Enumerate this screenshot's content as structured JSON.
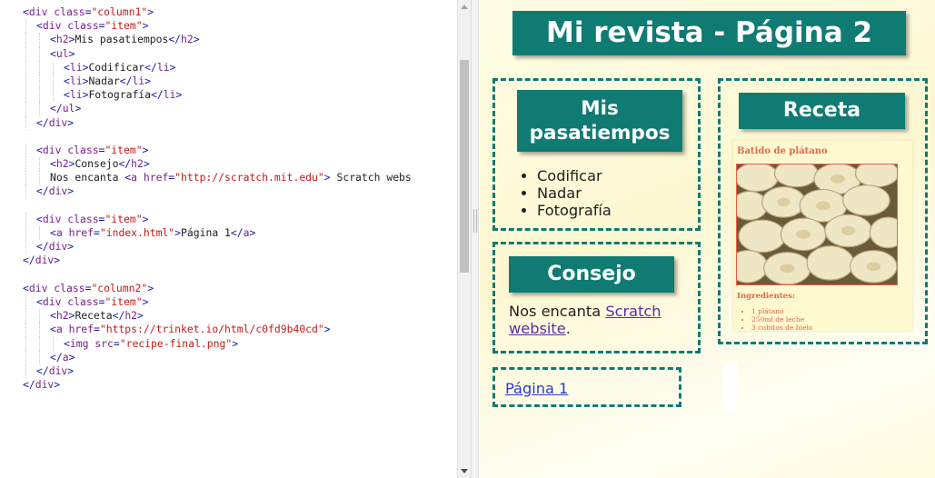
{
  "editor": {
    "lines": [
      {
        "indent": 0,
        "tokens": [
          [
            "p",
            "<"
          ],
          [
            "n",
            "div"
          ],
          [
            "t",
            " "
          ],
          [
            "a",
            "class"
          ],
          [
            "p",
            "="
          ],
          [
            "s",
            "\"column1\""
          ],
          [
            "p",
            ">"
          ]
        ]
      },
      {
        "indent": 1,
        "tokens": [
          [
            "p",
            "<"
          ],
          [
            "n",
            "div"
          ],
          [
            "t",
            " "
          ],
          [
            "a",
            "class"
          ],
          [
            "p",
            "="
          ],
          [
            "s",
            "\"item\""
          ],
          [
            "p",
            ">"
          ]
        ]
      },
      {
        "indent": 2,
        "tokens": [
          [
            "p",
            "<"
          ],
          [
            "n",
            "h2"
          ],
          [
            "p",
            ">"
          ],
          [
            "t",
            "Mis pasatiempos"
          ],
          [
            "p",
            "</"
          ],
          [
            "n",
            "h2"
          ],
          [
            "p",
            ">"
          ]
        ]
      },
      {
        "indent": 2,
        "tokens": [
          [
            "p",
            "<"
          ],
          [
            "n",
            "ul"
          ],
          [
            "p",
            ">"
          ]
        ]
      },
      {
        "indent": 3,
        "tokens": [
          [
            "p",
            "<"
          ],
          [
            "n",
            "li"
          ],
          [
            "p",
            ">"
          ],
          [
            "t",
            "Codificar"
          ],
          [
            "p",
            "</"
          ],
          [
            "n",
            "li"
          ],
          [
            "p",
            ">"
          ]
        ]
      },
      {
        "indent": 3,
        "tokens": [
          [
            "p",
            "<"
          ],
          [
            "n",
            "li"
          ],
          [
            "p",
            ">"
          ],
          [
            "t",
            "Nadar"
          ],
          [
            "p",
            "</"
          ],
          [
            "n",
            "li"
          ],
          [
            "p",
            ">"
          ]
        ]
      },
      {
        "indent": 3,
        "tokens": [
          [
            "p",
            "<"
          ],
          [
            "n",
            "li"
          ],
          [
            "p",
            ">"
          ],
          [
            "t",
            "Fotografía"
          ],
          [
            "p",
            "</"
          ],
          [
            "n",
            "li"
          ],
          [
            "p",
            ">"
          ]
        ]
      },
      {
        "indent": 2,
        "tokens": [
          [
            "p",
            "</"
          ],
          [
            "n",
            "ul"
          ],
          [
            "p",
            ">"
          ]
        ]
      },
      {
        "indent": 1,
        "tokens": [
          [
            "p",
            "</"
          ],
          [
            "n",
            "div"
          ],
          [
            "p",
            ">"
          ]
        ]
      },
      {
        "indent": 0,
        "tokens": []
      },
      {
        "indent": 1,
        "tokens": [
          [
            "p",
            "<"
          ],
          [
            "n",
            "div"
          ],
          [
            "t",
            " "
          ],
          [
            "a",
            "class"
          ],
          [
            "p",
            "="
          ],
          [
            "s",
            "\"item\""
          ],
          [
            "p",
            ">"
          ]
        ]
      },
      {
        "indent": 2,
        "tokens": [
          [
            "p",
            "<"
          ],
          [
            "n",
            "h2"
          ],
          [
            "p",
            ">"
          ],
          [
            "t",
            "Consejo"
          ],
          [
            "p",
            "</"
          ],
          [
            "n",
            "h2"
          ],
          [
            "p",
            ">"
          ]
        ]
      },
      {
        "indent": 2,
        "tokens": [
          [
            "t",
            "Nos encanta "
          ],
          [
            "p",
            "<"
          ],
          [
            "n",
            "a"
          ],
          [
            "t",
            " "
          ],
          [
            "a",
            "href"
          ],
          [
            "p",
            "="
          ],
          [
            "s",
            "\"http://scratch.mit.edu\""
          ],
          [
            "p",
            ">"
          ],
          [
            "t",
            " Scratch webs"
          ]
        ]
      },
      {
        "indent": 1,
        "tokens": [
          [
            "p",
            "</"
          ],
          [
            "n",
            "div"
          ],
          [
            "p",
            ">"
          ]
        ]
      },
      {
        "indent": 0,
        "tokens": []
      },
      {
        "indent": 1,
        "tokens": [
          [
            "p",
            "<"
          ],
          [
            "n",
            "div"
          ],
          [
            "t",
            " "
          ],
          [
            "a",
            "class"
          ],
          [
            "p",
            "="
          ],
          [
            "s",
            "\"item\""
          ],
          [
            "p",
            ">"
          ]
        ]
      },
      {
        "indent": 2,
        "tokens": [
          [
            "p",
            "<"
          ],
          [
            "n",
            "a"
          ],
          [
            "t",
            " "
          ],
          [
            "a",
            "href"
          ],
          [
            "p",
            "="
          ],
          [
            "s",
            "\"index.html\""
          ],
          [
            "p",
            ">"
          ],
          [
            "t",
            "Página 1"
          ],
          [
            "p",
            "</"
          ],
          [
            "n",
            "a"
          ],
          [
            "p",
            ">"
          ]
        ]
      },
      {
        "indent": 1,
        "tokens": [
          [
            "p",
            "</"
          ],
          [
            "n",
            "div"
          ],
          [
            "p",
            ">"
          ]
        ]
      },
      {
        "indent": 0,
        "tokens": [
          [
            "p",
            "</"
          ],
          [
            "n",
            "div"
          ],
          [
            "p",
            ">"
          ]
        ]
      },
      {
        "indent": 0,
        "tokens": []
      },
      {
        "indent": 0,
        "tokens": [
          [
            "p",
            "<"
          ],
          [
            "n",
            "div"
          ],
          [
            "t",
            " "
          ],
          [
            "a",
            "class"
          ],
          [
            "p",
            "="
          ],
          [
            "s",
            "\"column2\""
          ],
          [
            "p",
            ">"
          ]
        ]
      },
      {
        "indent": 1,
        "tokens": [
          [
            "p",
            "<"
          ],
          [
            "n",
            "div"
          ],
          [
            "t",
            " "
          ],
          [
            "a",
            "class"
          ],
          [
            "p",
            "="
          ],
          [
            "s",
            "\"item\""
          ],
          [
            "p",
            ">"
          ]
        ]
      },
      {
        "indent": 2,
        "tokens": [
          [
            "p",
            "<"
          ],
          [
            "n",
            "h2"
          ],
          [
            "p",
            ">"
          ],
          [
            "t",
            "Receta"
          ],
          [
            "p",
            "</"
          ],
          [
            "n",
            "h2"
          ],
          [
            "p",
            ">"
          ]
        ]
      },
      {
        "indent": 2,
        "tokens": [
          [
            "p",
            "<"
          ],
          [
            "n",
            "a"
          ],
          [
            "t",
            " "
          ],
          [
            "a",
            "href"
          ],
          [
            "p",
            "="
          ],
          [
            "s",
            "\"https://trinket.io/html/c0fd9b40cd\""
          ],
          [
            "p",
            ">"
          ]
        ]
      },
      {
        "indent": 3,
        "tokens": [
          [
            "p",
            "<"
          ],
          [
            "n",
            "img"
          ],
          [
            "t",
            " "
          ],
          [
            "a",
            "src"
          ],
          [
            "p",
            "="
          ],
          [
            "s",
            "\"recipe-final.png\""
          ],
          [
            "p",
            ">"
          ]
        ]
      },
      {
        "indent": 2,
        "tokens": [
          [
            "p",
            "</"
          ],
          [
            "n",
            "a"
          ],
          [
            "p",
            ">"
          ]
        ]
      },
      {
        "indent": 1,
        "tokens": [
          [
            "p",
            "</"
          ],
          [
            "n",
            "div"
          ],
          [
            "p",
            ">"
          ]
        ]
      },
      {
        "indent": 0,
        "tokens": [
          [
            "p",
            "</"
          ],
          [
            "n",
            "div"
          ],
          [
            "p",
            ">"
          ]
        ]
      }
    ]
  },
  "preview": {
    "title": "Mi revista - Página 2",
    "hobbies": {
      "heading": "Mis pasatiempos",
      "items": [
        "Codificar",
        "Nadar",
        "Fotografía"
      ]
    },
    "tip": {
      "heading": "Consejo",
      "text_before": "Nos encanta ",
      "link_text": "Scratch website",
      "text_after": "."
    },
    "nav": {
      "link_text": "Página 1"
    },
    "recipe": {
      "heading": "Receta",
      "card_title": "Batido de plátano",
      "ingredients_title": "Ingredientes:",
      "ingredients": [
        "1 plátano",
        "250ml de leche",
        "3 cubitos de hielo"
      ]
    }
  },
  "colors": {
    "accent": "#0f7b73",
    "link": "#5a2da8",
    "recipe_text": "#e0674a"
  }
}
